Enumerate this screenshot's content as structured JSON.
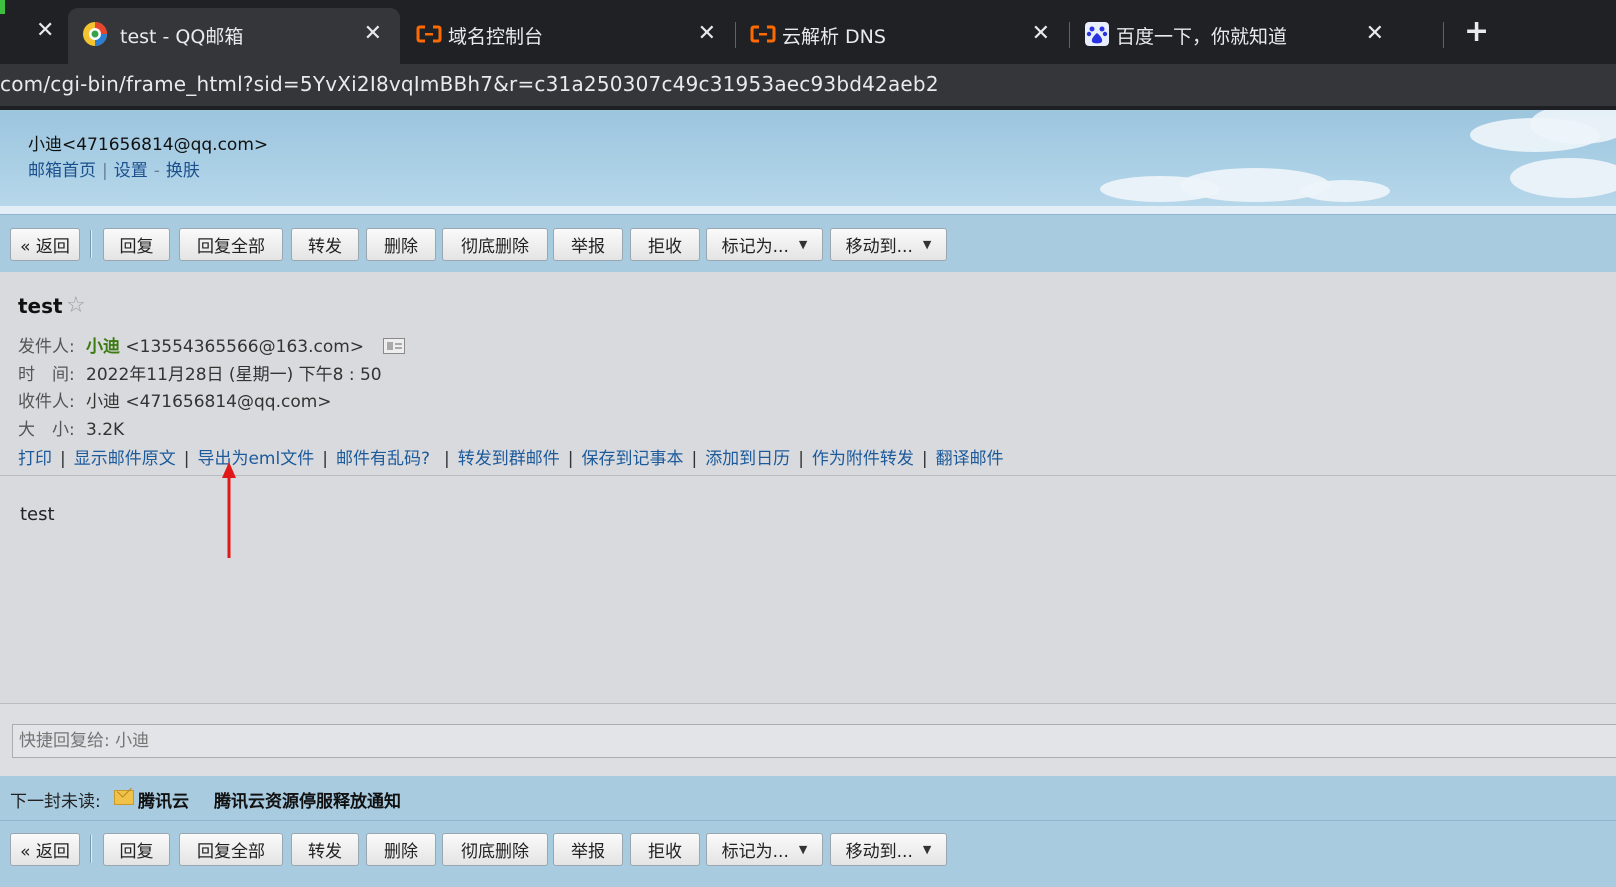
{
  "browser": {
    "tabs": [
      {
        "title": "test - QQ邮箱",
        "favicon": "qq-mail-icon",
        "active": true
      },
      {
        "title": "域名控制台",
        "favicon": "aliyun-icon",
        "active": false
      },
      {
        "title": "云解析 DNS",
        "favicon": "aliyun-icon",
        "active": false
      },
      {
        "title": "百度一下，你就知道",
        "favicon": "baidu-icon",
        "active": false
      }
    ],
    "close_glyph": "✕",
    "new_tab_glyph": "+",
    "url": "com/cgi-bin/frame_html?sid=5YvXi2I8vqImBBh7&r=c31a250307c49c31953aec93bd42aeb2"
  },
  "mailbox": {
    "user": "小迪<471656814@qq.com>",
    "links": {
      "home": "邮箱首页",
      "sep1": "|",
      "settings": "设置",
      "sep2": "-",
      "skin": "换肤"
    }
  },
  "toolbar": {
    "buttons": {
      "back": "« 返回",
      "reply": "回复",
      "reply_all": "回复全部",
      "forward": "转发",
      "delete": "删除",
      "delete_permanent": "彻底删除",
      "report": "举报",
      "reject": "拒收",
      "mark_as": "标记为...",
      "move_to": "移动到..."
    },
    "dropdown_glyph": "▼"
  },
  "mail": {
    "subject": "test",
    "star_glyph": "☆",
    "from_label": "发件人:",
    "from_name": "小迪",
    "from_addr": "<13554365566@163.com>",
    "time_label": "时　间:",
    "time_value": "2022年11月28日 (星期一) 下午8 : 50",
    "to_label": "收件人:",
    "to_value": "小迪 <471656814@qq.com>",
    "size_label": "大　小:",
    "size_value": "3.2K",
    "actions": {
      "print": "打印",
      "show_source": "显示邮件原文",
      "export_eml": "导出为eml文件",
      "garbled": "邮件有乱码?",
      "forward_group": "转发到群邮件",
      "save_note": "保存到记事本",
      "add_calendar": "添加到日历",
      "forward_attachment": "作为附件转发",
      "translate": "翻译邮件"
    },
    "body": "test"
  },
  "quick_reply": {
    "placeholder": "快捷回复给: 小迪"
  },
  "next_unread": {
    "label": "下一封未读:",
    "from": "腾讯云",
    "subject": "腾讯云资源停服释放通知"
  },
  "colors": {
    "chrome_dark": "#202124",
    "banner_blue": "#a9cfe5",
    "toolbar_blue": "#a8cbe0",
    "link_blue": "#1c5a9c",
    "sender_green": "#3c7a12",
    "annotation_red": "#e01818"
  }
}
